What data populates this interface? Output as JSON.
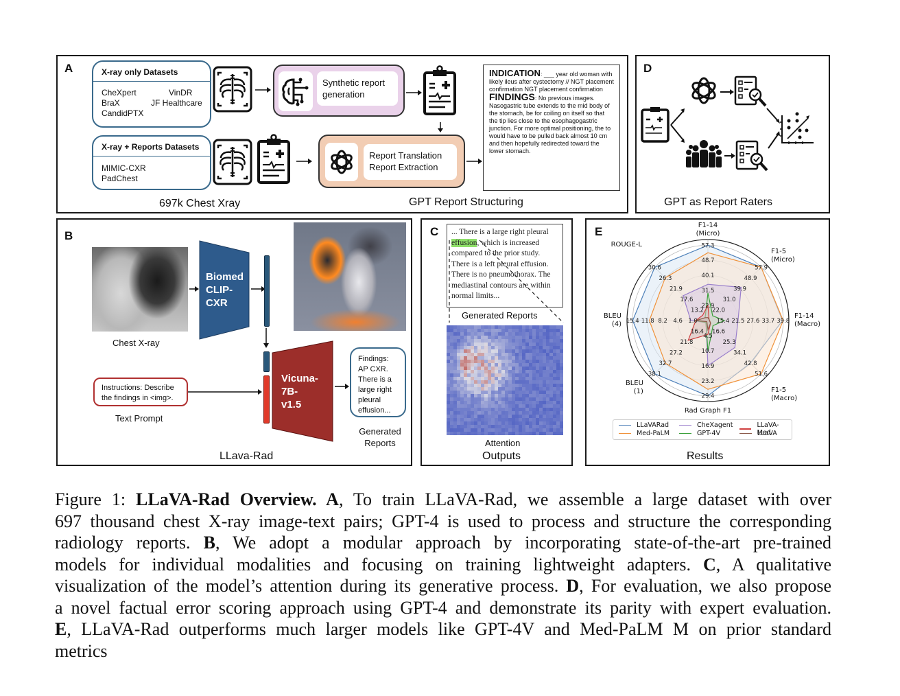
{
  "panels": {
    "A": {
      "label": "A",
      "xray_only": {
        "title": "X-ray only Datasets",
        "datasets": [
          "CheXpert",
          "VinDR",
          "BraX",
          "JF Healthcare",
          "CandidPTX"
        ]
      },
      "xray_reports": {
        "title": "X-ray + Reports Datasets",
        "datasets": [
          "MIMIC-CXR",
          "PadChest"
        ]
      },
      "synthetic": "Synthetic report generation",
      "translation": "Report Translation",
      "extraction": "Report Extraction",
      "report_example": {
        "indication_label": "INDICATION",
        "indication_text": ": ___ year old woman with likely ileus after cystectomy // NGT placement confirmation NGT placement confirmation",
        "findings_label": "FINDINGS",
        "findings_text": ": No previous images. Nasogastric tube extends to the mid body of the stomach, be for coiling on itself so that the tip lies close to the esophagogastric junction. For more optimal positioning, the to would have to be pulled back almost 10 cm and then hopefully redirected toward the lower stomach."
      },
      "caption_left": "697k Chest Xray",
      "caption_right": "GPT Report Structuring"
    },
    "D": {
      "label": "D",
      "caption": "GPT as Report Raters"
    },
    "B": {
      "label": "B",
      "xray_caption": "Chest X-ray",
      "encoder": [
        "Biomed",
        "CLIP-",
        "CXR"
      ],
      "llm": [
        "Vicuna-",
        "7B-",
        "v1.5"
      ],
      "prompt_text": "Instructions:  Describe the findings in <img>.",
      "prompt_caption": "Text Prompt",
      "generated_text": "Findings: AP CXR. There is a large right pleural effusion...",
      "generated_caption": [
        "Generated",
        "Reports"
      ],
      "caption": "LLava-Rad"
    },
    "C": {
      "label": "C",
      "text_pre": "... There is a large right pleural ",
      "text_highlight": "effusion",
      "text_post": ", which is increased compared to the prior study. There is a left pleural effusion. There is no pneumothorax. The mediastinal contours are within normal limits...",
      "text_caption": "Generated Reports",
      "attention_caption": "Attention",
      "caption": "Outputs"
    },
    "E": {
      "label": "E",
      "caption": "Results"
    }
  },
  "chart_data": {
    "type": "radar",
    "title": "",
    "axes": [
      {
        "name": "F1-14\n(Micro)",
        "ticks": [
          22.9,
          31.5,
          40.1,
          48.7,
          57.3
        ]
      },
      {
        "name": "F1-5\n(Micro)",
        "ticks": [
          22.0,
          31.0,
          39.9,
          48.9,
          57.9
        ]
      },
      {
        "name": "F1-14\n(Macro)",
        "ticks": [
          15.4,
          21.5,
          27.6,
          33.7,
          39.8
        ]
      },
      {
        "name": "F1-5\n(Macro)",
        "ticks": [
          16.6,
          25.3,
          34.1,
          42.8,
          51.6
        ]
      },
      {
        "name": "Rad Graph F1",
        "ticks": [
          4.5,
          10.7,
          16.9,
          23.2,
          29.4
        ]
      },
      {
        "name": "BLEU\n(1)",
        "ticks": [
          16.4,
          21.8,
          27.2,
          32.7,
          38.1
        ]
      },
      {
        "name": "BLEU\n(4)",
        "ticks": [
          1.0,
          4.6,
          8.2,
          11.8,
          15.4
        ]
      },
      {
        "name": "ROUGE-L",
        "ticks": [
          13.2,
          17.6,
          21.9,
          26.3,
          30.6
        ]
      }
    ],
    "series": [
      {
        "name": "LLaVARad",
        "color": "#4c7fb8",
        "fill": "#dbe8f4",
        "values": [
          57.3,
          57.9,
          39.5,
          42.8,
          29.4,
          38.1,
          15.4,
          30.6
        ]
      },
      {
        "name": "Med-PaLM",
        "color": "#f0923a",
        "fill": "#fbe6d2",
        "values": [
          53.0,
          57.9,
          39.8,
          51.6,
          26.7,
          32.7,
          11.4,
          26.3
        ]
      },
      {
        "name": "CheXagent",
        "color": "#9a7fcc",
        "fill": "#d8cbe5",
        "values": [
          35.0,
          41.0,
          21.5,
          30.0,
          16.9,
          12.0,
          1.5,
          19.0
        ]
      },
      {
        "name": "GPT-4V",
        "color": "#3aa03a",
        "fill": "#c8d8c0",
        "values": [
          30.0,
          17.0,
          16.0,
          12.0,
          11.0,
          12.0,
          0.5,
          10.0
        ]
      },
      {
        "name": "LLaVA-Med",
        "color": "#d04040",
        "fill": "#d8c0c0",
        "values": [
          23.0,
          14.0,
          10.0,
          10.0,
          4.0,
          21.0,
          0.3,
          11.0
        ]
      },
      {
        "name": "LLaVA",
        "color": "#8c5a4a",
        "fill": "#cfc0bb",
        "values": [
          16.0,
          13.0,
          9.0,
          10.0,
          2.0,
          11.0,
          0.2,
          10.0
        ]
      }
    ],
    "legend_position": "bottom",
    "legend_columns": 3
  },
  "caption": {
    "lines": [
      [
        {
          "t": "Figure 1: "
        },
        {
          "b": "LLaVA-Rad Overview. A"
        },
        {
          "t": ", To train LLaVA-Rad, we assemble a large dataset with over"
        }
      ],
      [
        {
          "t": "697 thousand chest X-ray image-text pairs; GPT-4 is used to process and structure the corresponding"
        }
      ],
      [
        {
          "t": "radiology reports.  "
        },
        {
          "b": "B"
        },
        {
          "t": ", We adopt a modular approach by incorporating state-of-the-art pre-trained"
        }
      ],
      [
        {
          "t": "models for individual modalities and focusing on training lightweight adapters.  "
        },
        {
          "b": "C"
        },
        {
          "t": ", A qualitative"
        }
      ],
      [
        {
          "t": "visualization of the model’s attention during its generative process. "
        },
        {
          "b": "D"
        },
        {
          "t": ", For evaluation, we also propose"
        }
      ],
      [
        {
          "t": "a novel factual error scoring approach using GPT-4 and demonstrate its parity with expert evaluation."
        }
      ],
      [
        {
          "b": "E"
        },
        {
          "t": ", LLaVA-Rad outperforms much larger models like GPT-4V and Med-PaLM M on prior standard"
        }
      ],
      [
        {
          "t": "metrics"
        }
      ]
    ]
  }
}
